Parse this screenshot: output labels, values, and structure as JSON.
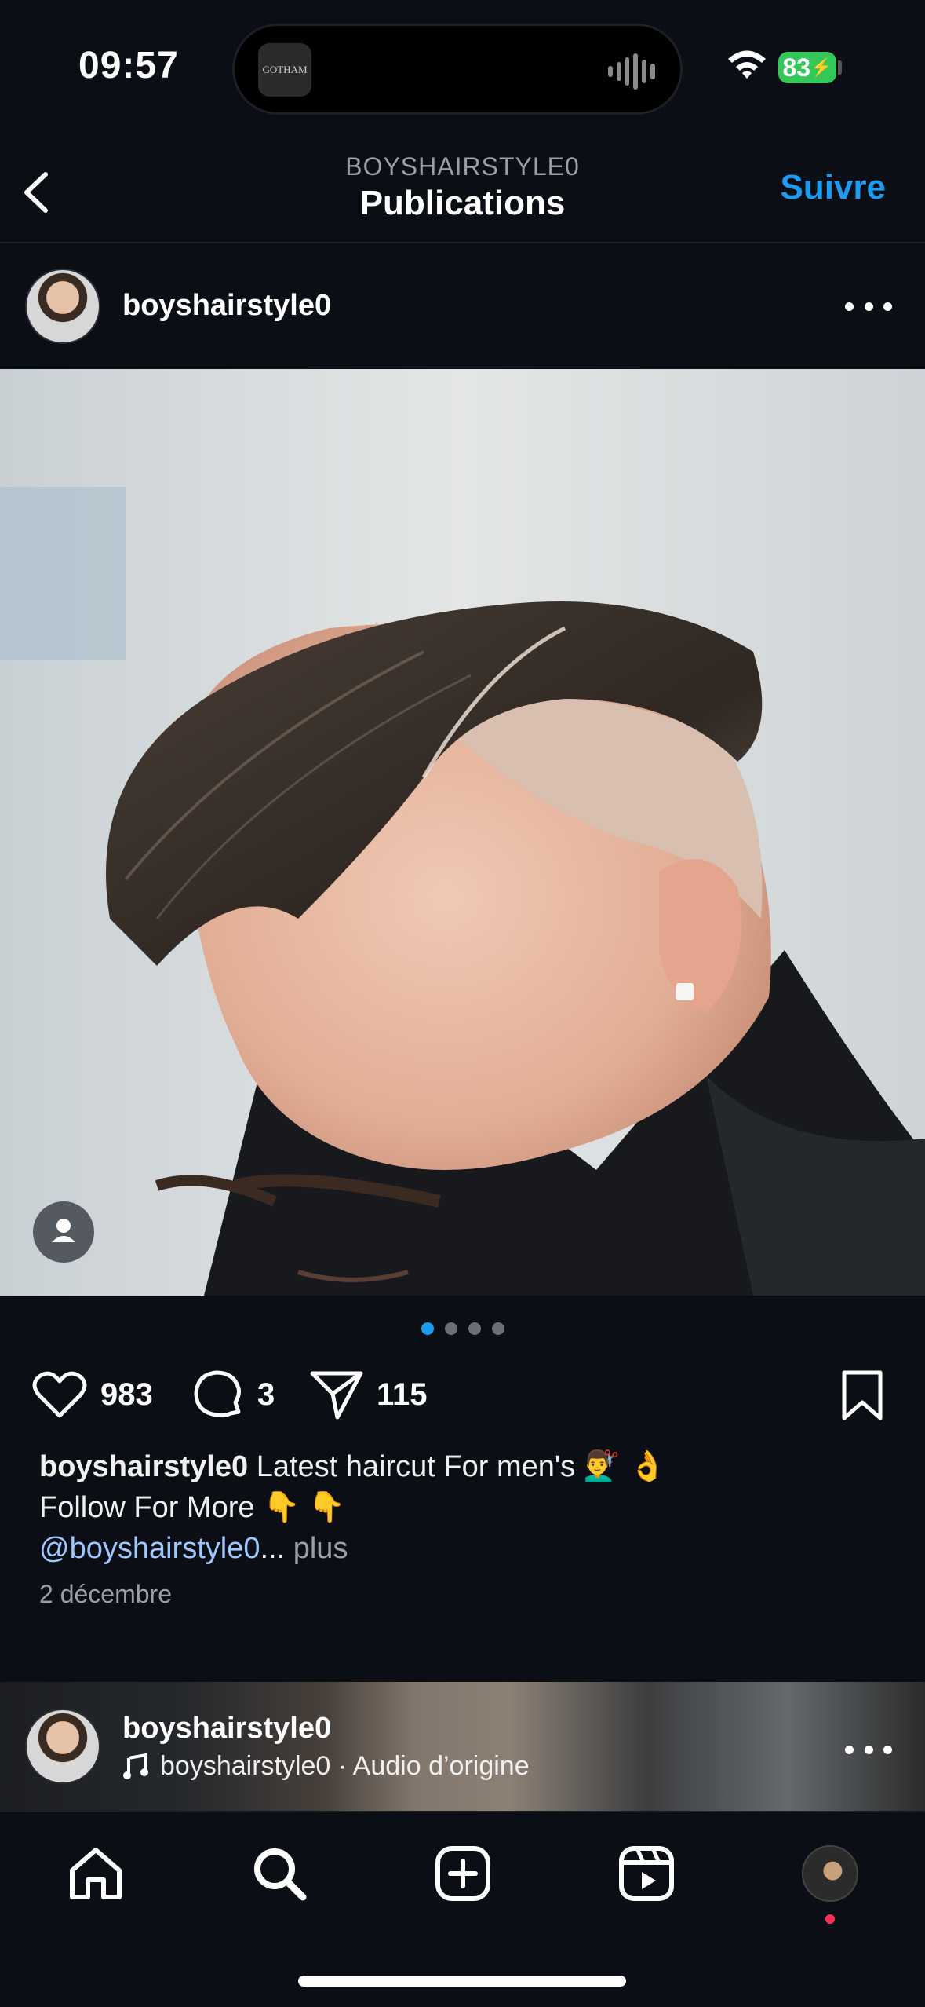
{
  "status_bar": {
    "time": "09:57",
    "battery": "83",
    "island_app": "GOTHAM"
  },
  "header": {
    "subtitle": "BOYSHAIRSTYLE0",
    "title": "Publications",
    "follow_label": "Suivre"
  },
  "post": {
    "username": "boyshairstyle0",
    "carousel": {
      "count": 4,
      "active_index": 0
    },
    "likes": "983",
    "comments": "3",
    "shares": "115",
    "caption_user": "boyshairstyle0",
    "caption_text": " Latest haircut For men's 💇‍♂️  👌",
    "caption_line2": "Follow For More  👇 👇",
    "caption_mention": "@boyshairstyle0",
    "caption_ellipsis": "...",
    "caption_more": " plus",
    "date": "2 décembre"
  },
  "next_post": {
    "username": "boyshairstyle0",
    "audio": "boyshairstyle0 · Audio d’origine"
  },
  "colors": {
    "accent": "#1d9bf0",
    "background": "#0b0f15",
    "battery": "#34c759",
    "notification": "#ff2d55"
  },
  "icons": [
    "back-chevron-icon",
    "more-dots-icon",
    "heart-icon",
    "comment-icon",
    "share-icon",
    "bookmark-icon",
    "person-tag-icon",
    "music-note-icon",
    "home-icon",
    "search-icon",
    "create-icon",
    "reels-icon"
  ]
}
